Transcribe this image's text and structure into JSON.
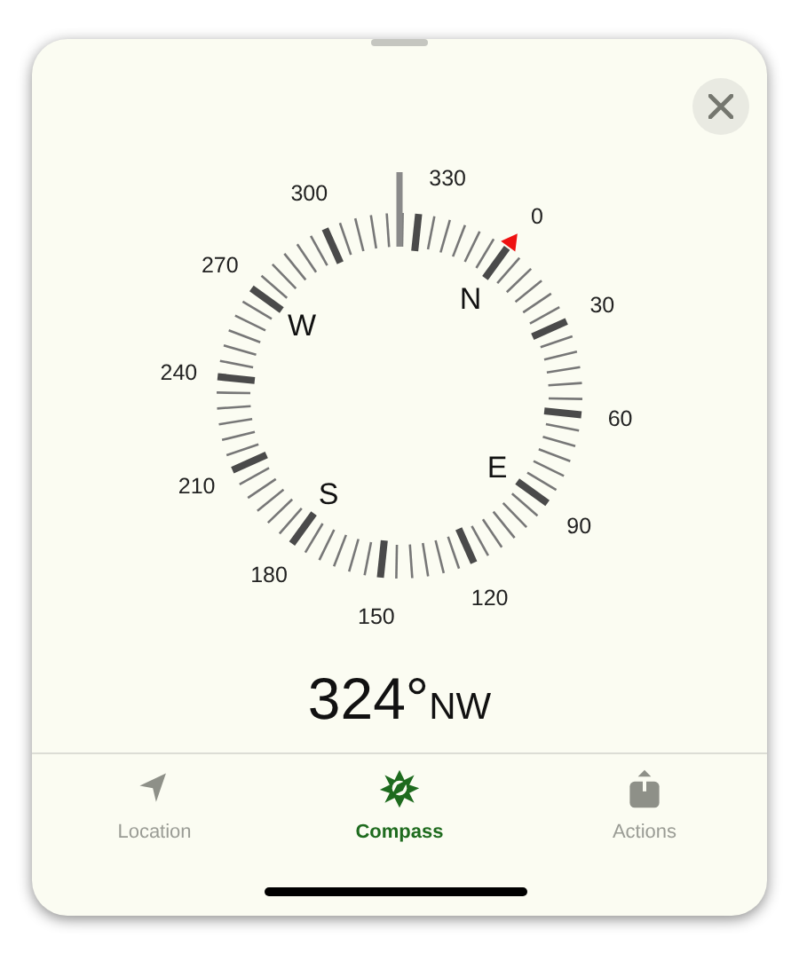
{
  "heading": {
    "degrees": "324°",
    "direction": "NW"
  },
  "dial": {
    "degree_labels": [
      "0",
      "30",
      "60",
      "90",
      "120",
      "150",
      "180",
      "210",
      "240",
      "270",
      "300",
      "330"
    ],
    "cardinals": [
      "N",
      "E",
      "S",
      "W"
    ]
  },
  "tabs": [
    {
      "label": "Location",
      "kind": "location",
      "selected": false
    },
    {
      "label": "Compass",
      "kind": "compass",
      "selected": true
    },
    {
      "label": "Actions",
      "kind": "share",
      "selected": false
    }
  ]
}
